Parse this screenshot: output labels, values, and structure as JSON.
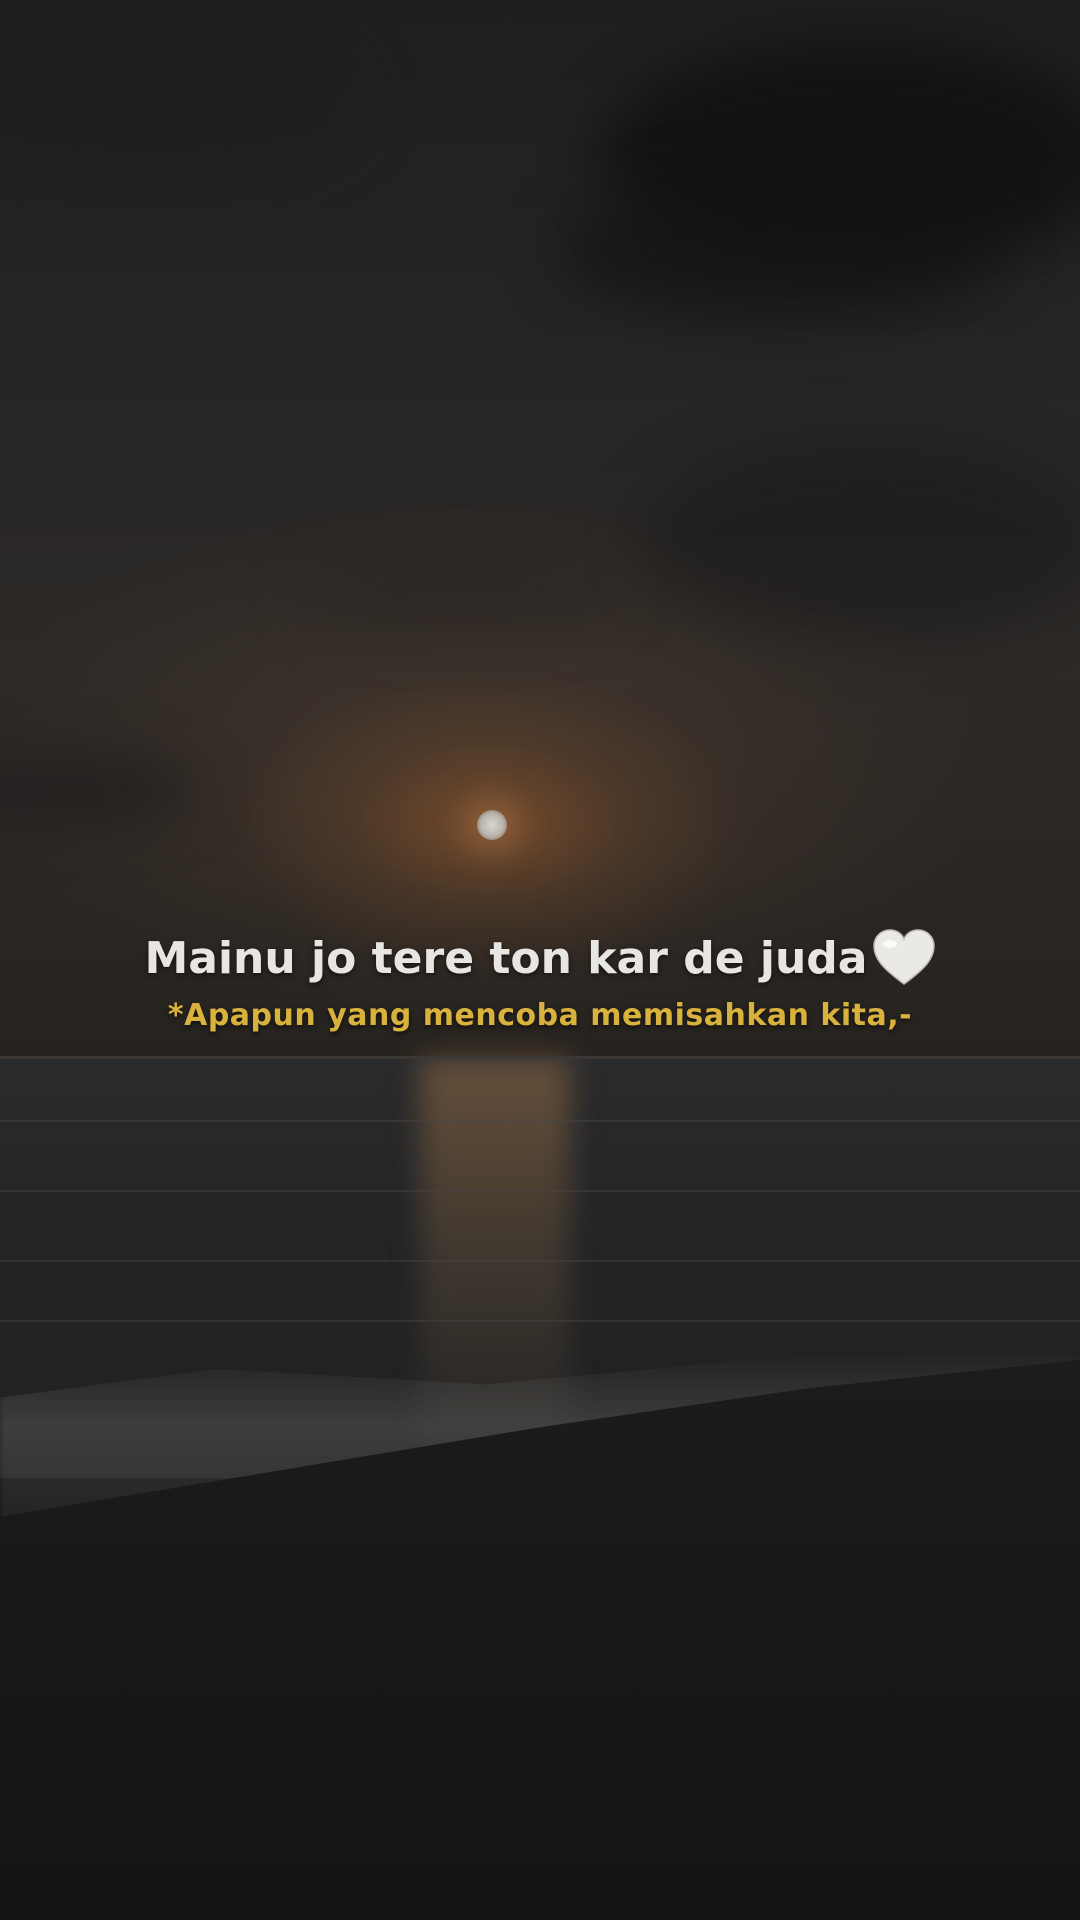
{
  "caption": {
    "text": "Mainu jo tere ton kar de juda",
    "emoji": "white-heart-icon",
    "translation": "*Apapun yang mencoba memisahkan kita,-"
  },
  "colors": {
    "caption_text": "#e8e6e3",
    "translation_text": "#d9b23d",
    "heart": "#ebe9e6"
  }
}
